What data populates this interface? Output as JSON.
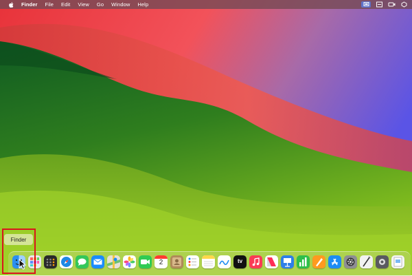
{
  "menubar": {
    "app_name": "Finder",
    "items": [
      "File",
      "Edit",
      "View",
      "Go",
      "Window",
      "Help"
    ],
    "status_icons": [
      "display-mirror-icon",
      "control-center-icon",
      "screen-record-icon",
      "overflow-icon"
    ]
  },
  "tooltip": {
    "text": "Finder"
  },
  "dock": {
    "apps": [
      {
        "name": "finder",
        "icon": "finder-icon",
        "color": "#2b8ff0"
      },
      {
        "name": "launchpad",
        "icon": "launchpad-icon",
        "color": "#e8e8ee"
      },
      {
        "name": "calculator",
        "icon": "calculator-icon",
        "color": "#2a2a2a"
      },
      {
        "name": "safari",
        "icon": "safari-icon",
        "color": "#1e88e5"
      },
      {
        "name": "messages",
        "icon": "messages-icon",
        "color": "#34c759"
      },
      {
        "name": "mail",
        "icon": "mail-icon",
        "color": "#1a8cff"
      },
      {
        "name": "maps",
        "icon": "maps-icon",
        "color": "#6cc070"
      },
      {
        "name": "photos",
        "icon": "photos-icon",
        "color": "#ffffff"
      },
      {
        "name": "facetime",
        "icon": "facetime-icon",
        "color": "#2fcb53"
      },
      {
        "name": "calendar",
        "icon": "calendar-icon",
        "color": "#ffffff",
        "day": "2"
      },
      {
        "name": "contacts",
        "icon": "contacts-icon",
        "color": "#b08a5a"
      },
      {
        "name": "reminders",
        "icon": "reminders-icon",
        "color": "#ffffff"
      },
      {
        "name": "notes",
        "icon": "notes-icon",
        "color": "#ffd84a"
      },
      {
        "name": "freeform",
        "icon": "freeform-icon",
        "color": "#ffffff"
      },
      {
        "name": "apple-tv",
        "icon": "apple-tv-icon",
        "color": "#111111",
        "label": "tv"
      },
      {
        "name": "music",
        "icon": "music-icon",
        "color": "#fa3b55"
      },
      {
        "name": "news",
        "icon": "news-icon",
        "color": "#ffffff"
      },
      {
        "name": "keynote",
        "icon": "keynote-icon",
        "color": "#2e7fe8"
      },
      {
        "name": "numbers",
        "icon": "numbers-icon",
        "color": "#2fbf4a"
      },
      {
        "name": "pages",
        "icon": "pages-icon",
        "color": "#ff9a1f"
      },
      {
        "name": "app-store",
        "icon": "app-store-icon",
        "color": "#1d8cf3"
      },
      {
        "name": "system-settings",
        "icon": "settings-icon",
        "color": "#8e8e93"
      },
      {
        "name": "script-editor",
        "icon": "script-editor-icon",
        "color": "#f2f2f2"
      },
      {
        "name": "screen-tool",
        "icon": "screenshot-icon",
        "color": "#5a5a60"
      },
      {
        "name": "document-viewer",
        "icon": "preview-icon",
        "color": "#f5f5f5"
      }
    ]
  }
}
